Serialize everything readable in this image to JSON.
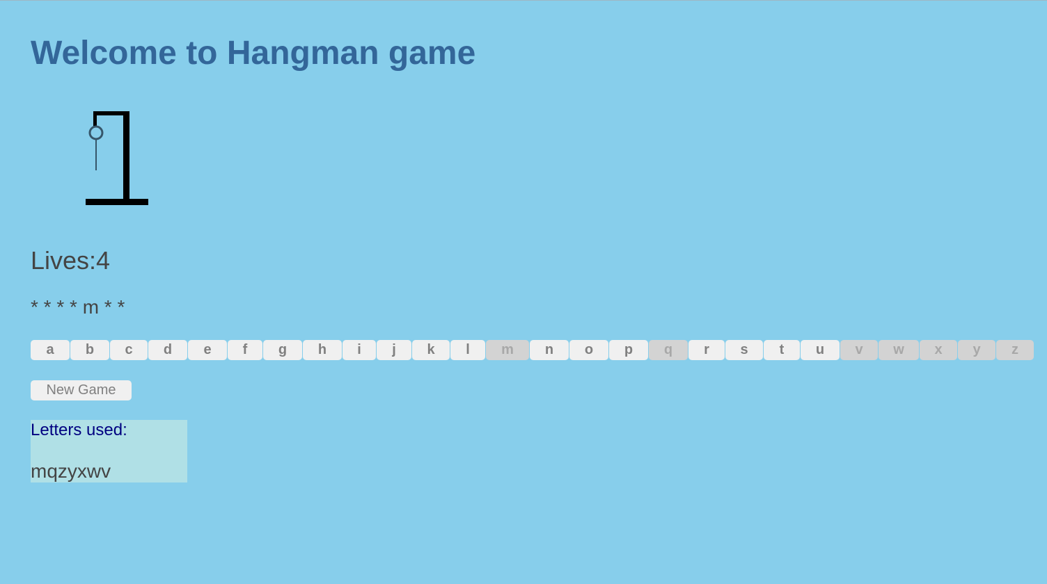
{
  "page": {
    "title": "Welcome to Hangman game"
  },
  "gallows": {
    "icon": "gallows-icon",
    "stage": 1
  },
  "status": {
    "lives_text": "Lives:4",
    "lives": 4,
    "masked_word": "* * * * m * *"
  },
  "alphabet": [
    {
      "letter": "a",
      "used": false
    },
    {
      "letter": "b",
      "used": false
    },
    {
      "letter": "c",
      "used": false
    },
    {
      "letter": "d",
      "used": false
    },
    {
      "letter": "e",
      "used": false
    },
    {
      "letter": "f",
      "used": false
    },
    {
      "letter": "g",
      "used": false
    },
    {
      "letter": "h",
      "used": false
    },
    {
      "letter": "i",
      "used": false
    },
    {
      "letter": "j",
      "used": false
    },
    {
      "letter": "k",
      "used": false
    },
    {
      "letter": "l",
      "used": false
    },
    {
      "letter": "m",
      "used": true
    },
    {
      "letter": "n",
      "used": false
    },
    {
      "letter": "o",
      "used": false
    },
    {
      "letter": "p",
      "used": false
    },
    {
      "letter": "q",
      "used": true
    },
    {
      "letter": "r",
      "used": false
    },
    {
      "letter": "s",
      "used": false
    },
    {
      "letter": "t",
      "used": false
    },
    {
      "letter": "u",
      "used": false
    },
    {
      "letter": "v",
      "used": true
    },
    {
      "letter": "w",
      "used": true
    },
    {
      "letter": "x",
      "used": true
    },
    {
      "letter": "y",
      "used": true
    },
    {
      "letter": "z",
      "used": true
    }
  ],
  "controls": {
    "new_game_label": "New Game"
  },
  "used_letters": {
    "label": "Letters used:",
    "value": "mqzyxwv"
  },
  "colors": {
    "background": "#87ceeb",
    "title": "#336699",
    "button": "#f0f0f0",
    "button_used": "#d3d3d3",
    "used_panel": "#b0e0e6",
    "used_label": "#000080"
  }
}
